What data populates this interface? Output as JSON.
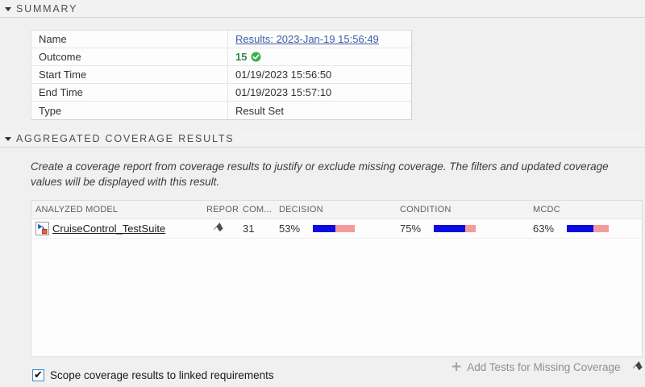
{
  "summary": {
    "title": "SUMMARY",
    "rows": [
      {
        "label": "Name",
        "value": "Results: 2023-Jan-19 15:56:49"
      },
      {
        "label": "Outcome",
        "value": "15"
      },
      {
        "label": "Start Time",
        "value": "01/19/2023 15:56:50"
      },
      {
        "label": "End Time",
        "value": "01/19/2023 15:57:10"
      },
      {
        "label": "Type",
        "value": "Result Set"
      }
    ]
  },
  "coverage": {
    "title": "AGGREGATED COVERAGE RESULTS",
    "description": "Create a coverage report from coverage results to justify or exclude missing coverage. The filters and updated coverage values will be displayed with this result.",
    "table": {
      "headers": {
        "model": "ANALYZED MODEL",
        "report": "REPORT",
        "complexity": "COM...",
        "decision": "DECISION",
        "condition": "CONDITION",
        "mcdc": "MCDC"
      },
      "row": {
        "model": "CruiseControl_TestSuite",
        "complexity": "31",
        "decision_label": "53%",
        "decision_pct": 53,
        "condition_label": "75%",
        "condition_pct": 75,
        "mcdc_label": "63%",
        "mcdc_pct": 63
      }
    },
    "add_tests_label": "Add Tests for Missing Coverage",
    "checkbox": {
      "label": "Scope coverage results to linked requirements",
      "checked": true,
      "glyph": "✔"
    }
  },
  "icons": {
    "plus": "+",
    "flag": "⚑"
  },
  "colors": {
    "bar_covered": "#0c0ce0",
    "bar_missing": "#f59b9b",
    "outcome_green": "#2e8b46",
    "link_blue": "#3c5fa8",
    "page_bg": "#f0f0f0"
  }
}
